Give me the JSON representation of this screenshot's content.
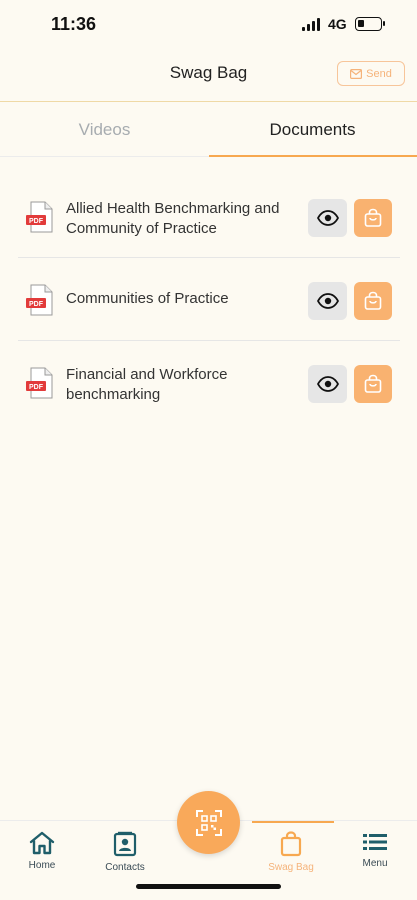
{
  "status_bar": {
    "time": "11:36",
    "network": "4G"
  },
  "header": {
    "title": "Swag Bag",
    "send_label": "Send"
  },
  "tabs": [
    {
      "label": "Videos",
      "active": false
    },
    {
      "label": "Documents",
      "active": true
    }
  ],
  "documents": [
    {
      "title": "Allied Health Benchmarking and Community of Practice",
      "file_type": "PDF"
    },
    {
      "title": "Communities of Practice",
      "file_type": "PDF"
    },
    {
      "title": "Financial and Workforce benchmarking",
      "file_type": "PDF"
    }
  ],
  "bottom_nav": {
    "home": "Home",
    "contacts": "Contacts",
    "swag_bag": "Swag Bag",
    "menu": "Menu"
  },
  "colors": {
    "accent": "#f7a850",
    "background": "#fdfaf2",
    "nav_icon": "#1f5e6a",
    "pdf_red": "#e23b3b"
  },
  "icons": {
    "send": "envelope-icon",
    "view": "eye-icon",
    "bag": "shopping-bag-icon",
    "fab": "qr-scan-icon"
  }
}
